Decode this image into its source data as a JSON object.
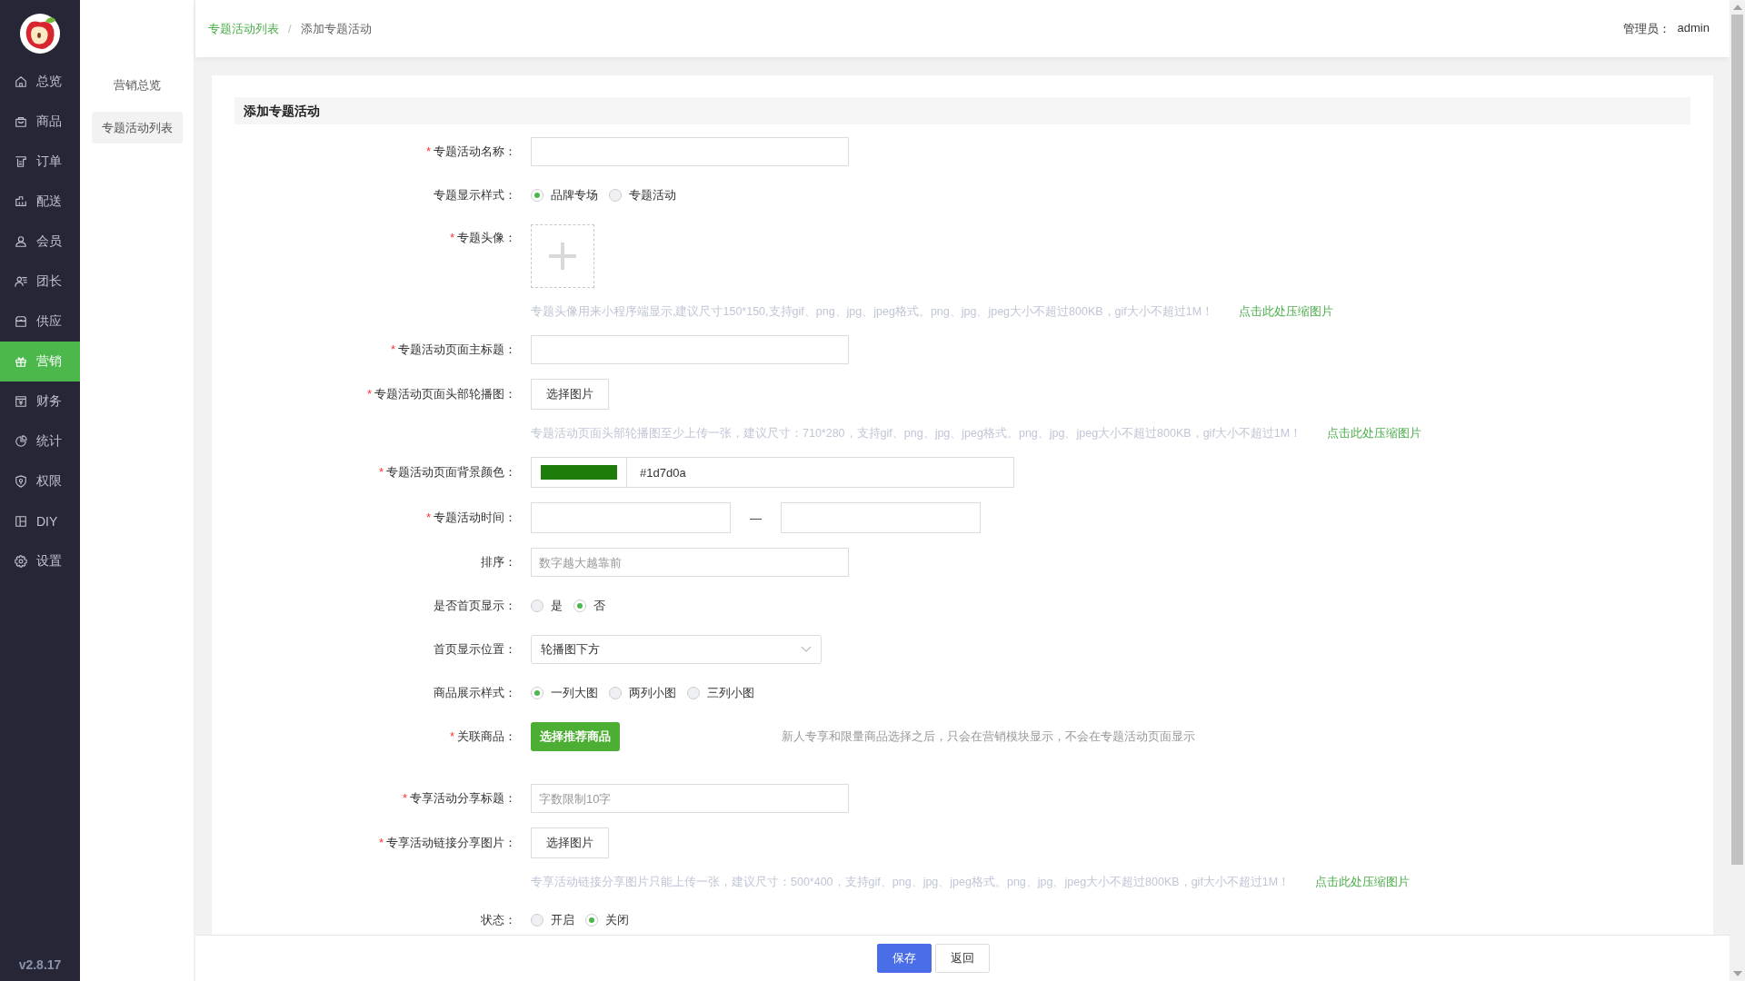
{
  "sidebar": {
    "items": [
      {
        "label": "总览",
        "selected": false
      },
      {
        "label": "商品",
        "selected": false
      },
      {
        "label": "订单",
        "selected": false
      },
      {
        "label": "配送",
        "selected": false
      },
      {
        "label": "会员",
        "selected": false
      },
      {
        "label": "团长",
        "selected": false
      },
      {
        "label": "供应",
        "selected": false
      },
      {
        "label": "营销",
        "selected": true
      },
      {
        "label": "财务",
        "selected": false
      },
      {
        "label": "统计",
        "selected": false
      },
      {
        "label": "权限",
        "selected": false
      },
      {
        "label": "DIY",
        "selected": false
      },
      {
        "label": "设置",
        "selected": false
      }
    ],
    "version": "v2.8.17"
  },
  "subnav": {
    "items": [
      {
        "label": "营销总览",
        "selected": false
      },
      {
        "label": "专题活动列表",
        "selected": true
      }
    ]
  },
  "header": {
    "breadcrumb": [
      {
        "label": "专题活动列表",
        "kind": "link"
      },
      {
        "label": "添加专题活动",
        "kind": "current"
      }
    ],
    "separator": "/",
    "admin_label": "管理员：",
    "admin_name": "admin"
  },
  "form": {
    "title": "添加专题活动",
    "fields": [
      {
        "kind": "input",
        "required_mark": "*",
        "label": "专题活动名称："
      },
      {
        "kind": "radio",
        "label": "专题显示样式：",
        "options": [
          {
            "label": "品牌专场",
            "selected": true
          },
          {
            "label": "专题活动",
            "selected": false
          }
        ]
      },
      {
        "kind": "upload",
        "required_mark": "*",
        "label": "专题头像："
      },
      {
        "kind": "hint",
        "text": "专题头像用来小程序端显示,建议尺寸150*150,支持gif、png、jpg、jpeg格式。png、jpg、jpeg大小不超过800KB，gif大小不超过1M！",
        "link": "点击此处压缩图片"
      },
      {
        "kind": "input",
        "required_mark": "*",
        "label": "专题活动页面主标题："
      },
      {
        "kind": "file",
        "required_mark": "*",
        "label": "专题活动页面头部轮播图：",
        "button": "选择图片"
      },
      {
        "kind": "hint",
        "text": "专题活动页面头部轮播图至少上传一张，建议尺寸：710*280，支持gif、png、jpg、jpeg格式。png、jpg、jpeg大小不超过800KB，gif大小不超过1M！",
        "link": "点击此处压缩图片"
      },
      {
        "kind": "color",
        "required_mark": "*",
        "label": "专题活动页面背景颜色：",
        "value": "#1d7d0a"
      },
      {
        "kind": "daterange",
        "required_mark": "*",
        "label": "专题活动时间：",
        "separator": "—"
      },
      {
        "kind": "input",
        "label": "排序：",
        "placeholder": "数字越大越靠前"
      },
      {
        "kind": "radio",
        "label": "是否首页显示：",
        "options": [
          {
            "label": "是",
            "selected": false
          },
          {
            "label": "否",
            "selected": true
          }
        ]
      },
      {
        "kind": "select",
        "label": "首页显示位置：",
        "value": "轮播图下方"
      },
      {
        "kind": "radio",
        "label": "商品展示样式：",
        "options": [
          {
            "label": "一列大图",
            "selected": true
          },
          {
            "label": "两列小图",
            "selected": false
          },
          {
            "label": "三列小图",
            "selected": false
          }
        ]
      },
      {
        "kind": "action",
        "required_mark": "*",
        "label": "关联商品：",
        "button": "选择推荐商品",
        "note": "新人专享和限量商品选择之后，只会在营销模块显示，不会在专题活动页面显示"
      },
      {
        "kind": "input",
        "required_mark": "*",
        "label": "专享活动分享标题：",
        "placeholder": "字数限制10字"
      },
      {
        "kind": "file",
        "required_mark": "*",
        "label": "专享活动链接分享图片：",
        "button": "选择图片"
      },
      {
        "kind": "hint",
        "text": "专享活动链接分享图片只能上传一张，建议尺寸：500*400，支持gif、png、jpg、jpeg格式。png、jpg、jpeg大小不超过800KB，gif大小不超过1M！",
        "link": "点击此处压缩图片"
      },
      {
        "kind": "radio",
        "label": "状态：",
        "options": [
          {
            "label": "开启",
            "selected": false
          },
          {
            "label": "关闭",
            "selected": true
          }
        ]
      }
    ]
  },
  "footer": {
    "buttons": [
      {
        "label": "保存",
        "kind": "primary"
      },
      {
        "label": "返回",
        "kind": "default"
      }
    ]
  }
}
